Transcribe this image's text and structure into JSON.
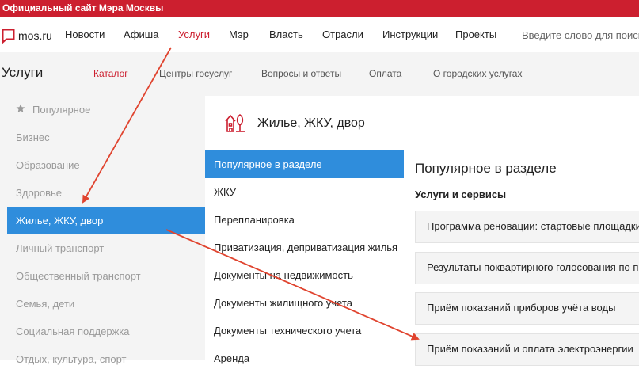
{
  "topbar": {
    "text": "Официальный сайт Мэра Москвы"
  },
  "nav": {
    "logo_text": "mos.ru",
    "items": [
      "Новости",
      "Афиша",
      "Услуги",
      "Мэр",
      "Власть",
      "Отрасли",
      "Инструкции",
      "Проекты"
    ],
    "active_item": "Услуги",
    "search_placeholder": "Введите слово для поиска"
  },
  "subnav": {
    "title": "Услуги",
    "items": [
      "Каталог",
      "Центры госуслуг",
      "Вопросы и ответы",
      "Оплата",
      "О городских услугах"
    ],
    "active_item": "Каталог"
  },
  "categories": {
    "popular_icon": "star-icon",
    "items": [
      "Популярное",
      "Бизнес",
      "Образование",
      "Здоровье",
      "Жилье, ЖКУ, двор",
      "Личный транспорт",
      "Общественный транспорт",
      "Семья, дети",
      "Социальная поддержка",
      "Отдых, культура, спорт"
    ],
    "active_item": "Жилье, ЖКУ, двор"
  },
  "section_header": {
    "icon": "house-tree-icon",
    "title": "Жилье, ЖКУ, двор"
  },
  "sections": {
    "items": [
      "Популярное в разделе",
      "ЖКУ",
      "Перепланировка",
      "Приватизация, деприватизация жилья",
      "Документы на недвижимость",
      "Документы жилищного учета",
      "Документы технического учета",
      "Аренда"
    ],
    "active_item": "Популярное в разделе"
  },
  "content": {
    "title": "Популярное в разделе",
    "subtitle": "Услуги и сервисы",
    "cards": [
      "Программа реновации: стартовые площадки",
      "Результаты поквартирного голосования по программе",
      "Приём показаний приборов учёта воды",
      "Приём показаний и оплата электроэнергии"
    ]
  },
  "colors": {
    "brand_red": "#cc1f2f",
    "active_blue": "#2f8ddc",
    "annotation_arrow": "#e0442f"
  }
}
